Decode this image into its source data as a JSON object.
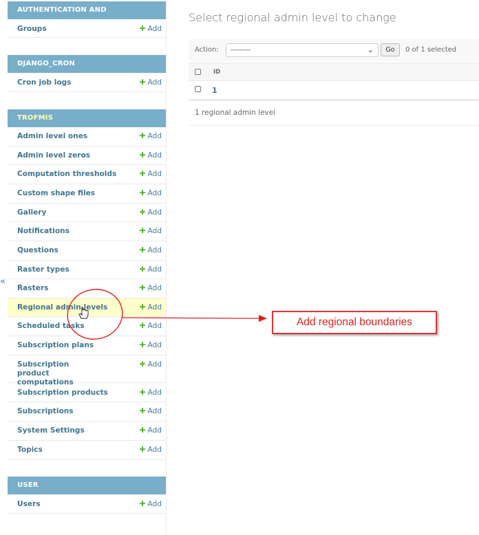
{
  "sidebar": {
    "collapse_glyph": "«",
    "apps": [
      {
        "caption": "AUTHENTICATION AND AUTHORIZATION",
        "active": false,
        "models": [
          {
            "name": "Groups",
            "add": "Add"
          }
        ]
      },
      {
        "caption": "DJANGO_CRON",
        "active": false,
        "models": [
          {
            "name": "Cron job logs",
            "add": "Add"
          }
        ]
      },
      {
        "caption": "TROFMIS",
        "active": true,
        "models": [
          {
            "name": "Admin level ones",
            "add": "Add"
          },
          {
            "name": "Admin level zeros",
            "add": "Add"
          },
          {
            "name": "Computation thresholds",
            "add": "Add"
          },
          {
            "name": "Custom shape files",
            "add": "Add"
          },
          {
            "name": "Gallery",
            "add": "Add"
          },
          {
            "name": "Notifications",
            "add": "Add"
          },
          {
            "name": "Questions",
            "add": "Add"
          },
          {
            "name": "Raster types",
            "add": "Add"
          },
          {
            "name": "Rasters",
            "add": "Add"
          },
          {
            "name": "Regional admin levels",
            "add": "Add",
            "selected": true
          },
          {
            "name": "Scheduled tasks",
            "add": "Add"
          },
          {
            "name": "Subscription plans",
            "add": "Add"
          },
          {
            "name": "Subscription product computations",
            "add": "Add"
          },
          {
            "name": "Subscription products",
            "add": "Add"
          },
          {
            "name": "Subscriptions",
            "add": "Add"
          },
          {
            "name": "System Settings",
            "add": "Add"
          },
          {
            "name": "Topics",
            "add": "Add"
          }
        ]
      },
      {
        "caption": "USER",
        "active": false,
        "models": [
          {
            "name": "Users",
            "add": "Add"
          }
        ]
      }
    ]
  },
  "main": {
    "title": "Select regional admin level to change",
    "action_label": "Action:",
    "action_selected": "---------",
    "go_label": "Go",
    "selection_counter": "0 of 1 selected",
    "columns": [
      "ID"
    ],
    "rows": [
      {
        "id": "1"
      }
    ],
    "paginator": "1 regional admin level"
  },
  "annotation": {
    "callout_text": "Add regional boundaries",
    "color": "#e02020"
  },
  "colors": {
    "caption_bg": "#79aec8",
    "link": "#417690",
    "add_plus": "#58b336",
    "selected_row": "#ffffcc"
  }
}
